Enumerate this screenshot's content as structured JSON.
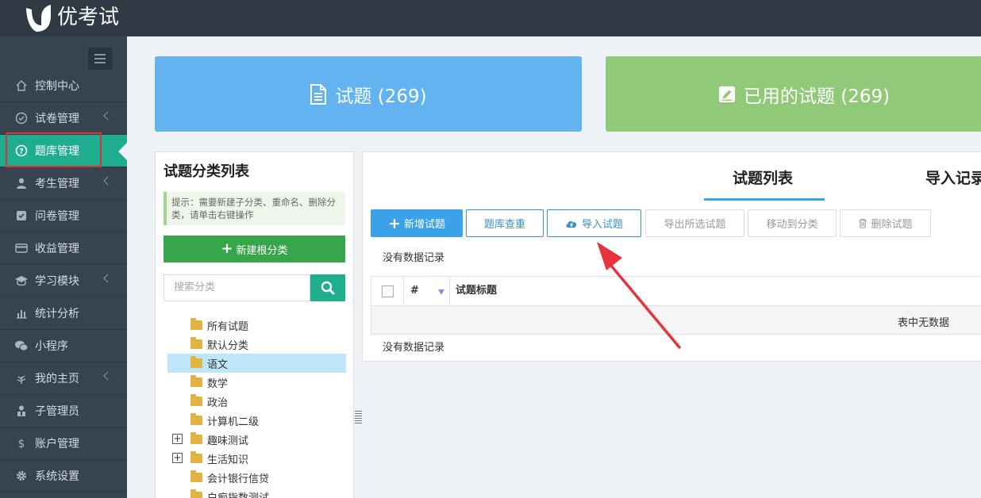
{
  "app": {
    "name": "优考试"
  },
  "sidebar": {
    "items": [
      {
        "label": "控制中心",
        "icon": "home-icon",
        "has_submenu": false,
        "active": false
      },
      {
        "label": "试卷管理",
        "icon": "check-circle-icon",
        "has_submenu": true,
        "active": false
      },
      {
        "label": "题库管理",
        "icon": "question-circle-icon",
        "has_submenu": false,
        "active": true
      },
      {
        "label": "考生管理",
        "icon": "user-icon",
        "has_submenu": true,
        "active": false
      },
      {
        "label": "问卷管理",
        "icon": "checkbox-icon",
        "has_submenu": false,
        "active": false
      },
      {
        "label": "收益管理",
        "icon": "credit-card-icon",
        "has_submenu": false,
        "active": false
      },
      {
        "label": "学习模块",
        "icon": "graduation-cap-icon",
        "has_submenu": true,
        "active": false
      },
      {
        "label": "统计分析",
        "icon": "bar-chart-icon",
        "has_submenu": false,
        "active": false
      },
      {
        "label": "小程序",
        "icon": "wechat-icon",
        "has_submenu": false,
        "active": false
      },
      {
        "label": "我的主页",
        "icon": "leaf-icon",
        "has_submenu": true,
        "active": false
      },
      {
        "label": "子管理员",
        "icon": "user-tie-icon",
        "has_submenu": false,
        "active": false
      },
      {
        "label": "账户管理",
        "icon": "dollar-icon",
        "has_submenu": false,
        "active": false
      },
      {
        "label": "系统设置",
        "icon": "gear-icon",
        "has_submenu": false,
        "active": false
      }
    ]
  },
  "stats": {
    "questions_label": "试题 (269)",
    "used_questions_label": "已用的试题 (269)"
  },
  "category": {
    "title": "试题分类列表",
    "hint": "提示：需要新建子分类、重命名、删除分类，请单击右键操作",
    "new_root_label": "新建根分类",
    "search_placeholder": "搜索分类",
    "tree": [
      {
        "label": "所有试题",
        "expandable": false,
        "selected": false
      },
      {
        "label": "默认分类",
        "expandable": false,
        "selected": false
      },
      {
        "label": "语文",
        "expandable": false,
        "selected": true
      },
      {
        "label": "数学",
        "expandable": false,
        "selected": false
      },
      {
        "label": "政治",
        "expandable": false,
        "selected": false
      },
      {
        "label": "计算机二级",
        "expandable": false,
        "selected": false
      },
      {
        "label": "趣味测试",
        "expandable": true,
        "selected": false
      },
      {
        "label": "生活知识",
        "expandable": true,
        "selected": false
      },
      {
        "label": "会计银行信贷",
        "expandable": false,
        "selected": false
      },
      {
        "label": "白痴指数测试",
        "expandable": false,
        "selected": false
      }
    ]
  },
  "question_list": {
    "tabs": [
      "试题列表",
      "导入记录"
    ],
    "toolbar": {
      "new_label": "新增试题",
      "dedupe_label": "题库查重",
      "import_label": "导入试题",
      "export_label": "导出所选试题",
      "move_label": "移动到分类",
      "delete_label": "删除试题"
    },
    "no_records": "没有数据记录",
    "table": {
      "columns": [
        "#",
        "试题标题"
      ],
      "empty_text": "表中无数据"
    }
  },
  "colors": {
    "sidebar_active": "#1fad8f",
    "card_blue": "#62b3ef",
    "card_green": "#90c978",
    "annotation_red": "#e0303a"
  }
}
